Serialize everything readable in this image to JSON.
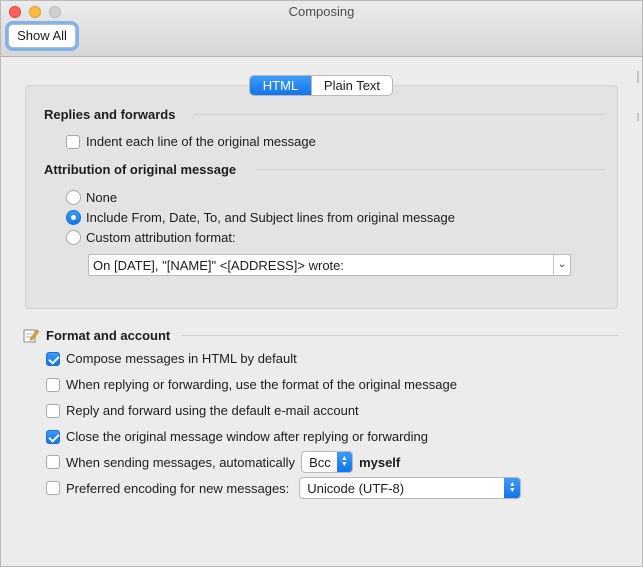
{
  "window": {
    "title": "Composing"
  },
  "toolbar": {
    "show_all": "Show All"
  },
  "tabs": [
    {
      "label": "HTML",
      "active": true
    },
    {
      "label": "Plain Text",
      "active": false
    }
  ],
  "replies": {
    "heading": "Replies and forwards",
    "indent_label": "Indent each line of the original message",
    "indent_checked": false
  },
  "attribution": {
    "heading": "Attribution of original message",
    "options": [
      {
        "label": "None",
        "selected": false
      },
      {
        "label": "Include From, Date, To, and Subject lines from original message",
        "selected": true
      },
      {
        "label": "Custom attribution format:",
        "selected": false
      }
    ],
    "custom_format_value": "On [DATE], \"[NAME]\" <[ADDRESS]> wrote:"
  },
  "format": {
    "heading": "Format and account",
    "options": [
      {
        "label": "Compose messages in HTML by default",
        "checked": true
      },
      {
        "label": "When replying or forwarding, use the format of the original message",
        "checked": false
      },
      {
        "label": "Reply and forward using the default e-mail account",
        "checked": false
      },
      {
        "label": "Close the original message window after replying or forwarding",
        "checked": true
      },
      {
        "label": "When sending messages, automatically",
        "checked": false,
        "select_value": "Bcc",
        "suffix": "myself"
      },
      {
        "label": "Preferred encoding for new messages:",
        "checked": false,
        "select_value": "Unicode (UTF-8)"
      }
    ]
  },
  "colors": {
    "accent": "#1474e9",
    "focus_ring": "#7fb3ee",
    "group_bg": "#e3e3e3"
  }
}
